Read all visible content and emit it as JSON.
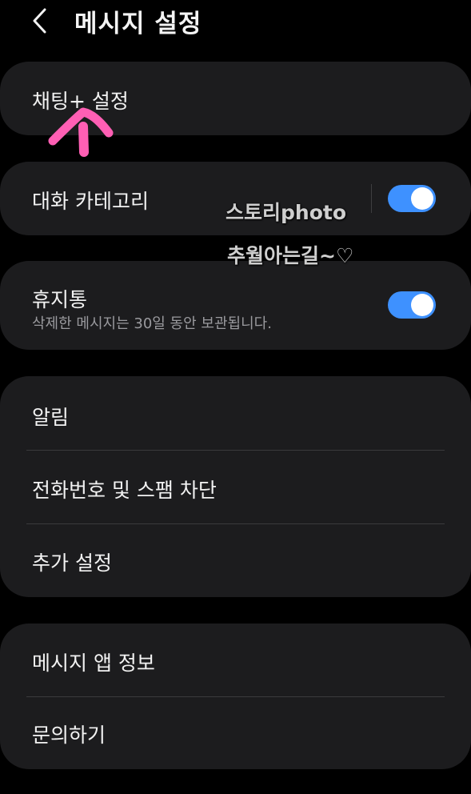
{
  "header": {
    "back_icon": "chevron-left-icon",
    "title": "메시지 설정"
  },
  "colors": {
    "background": "#000000",
    "card": "#1c1c1e",
    "toggle_on": "#3e91ff",
    "annotation": "#ff5fb4"
  },
  "sections": {
    "chat_plus": {
      "label": "채팅+ 설정"
    },
    "conversation_categories": {
      "label": "대화 카테고리",
      "toggle_on": true
    },
    "trash": {
      "label": "휴지통",
      "description": "삭제한 메시지는 30일 동안 보관됩니다.",
      "toggle_on": true
    },
    "general": {
      "items": [
        {
          "label": "알림"
        },
        {
          "label": "전화번호 및 스팸 차단"
        },
        {
          "label": "추가 설정"
        }
      ]
    },
    "about": {
      "items": [
        {
          "label": "메시지 앱 정보"
        },
        {
          "label": "문의하기"
        }
      ]
    }
  },
  "watermark": {
    "line1": "스토리photo",
    "line2": "추월아는길~♡"
  },
  "annotation": {
    "icon": "hand-drawn-arrow-up-icon"
  }
}
